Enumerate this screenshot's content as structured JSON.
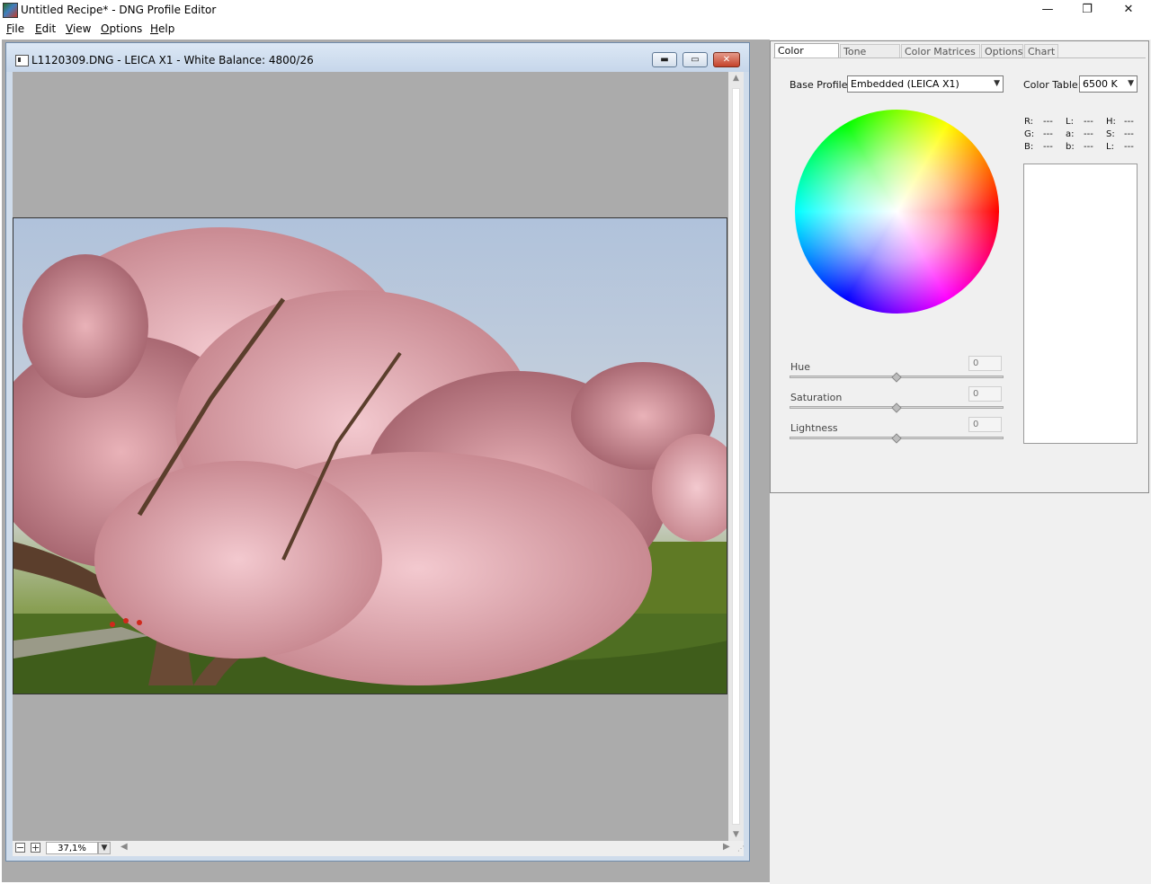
{
  "window": {
    "title": "Untitled Recipe* - DNG Profile Editor",
    "minimize": "—",
    "restore": "❐",
    "close": "✕"
  },
  "menu": {
    "items": [
      {
        "label": "File",
        "mnemonic": "F"
      },
      {
        "label": "Edit",
        "mnemonic": "E"
      },
      {
        "label": "View",
        "mnemonic": "V"
      },
      {
        "label": "Options",
        "mnemonic": "O"
      },
      {
        "label": "Help",
        "mnemonic": "H"
      }
    ]
  },
  "document": {
    "title": "L1120309.DNG  - LEICA X1 - White Balance: 4800/26",
    "minimize": "▬",
    "maximize": "▭",
    "close": "✕",
    "zoom_value": "37,1%",
    "zoom_out": "−",
    "zoom_in": "+"
  },
  "panel": {
    "tabs": [
      {
        "label": "Color Tables",
        "active": true
      },
      {
        "label": "Tone Curve",
        "active": false
      },
      {
        "label": "Color Matrices",
        "active": false
      },
      {
        "label": "Options",
        "active": false
      },
      {
        "label": "Chart",
        "active": false
      }
    ],
    "base_profile_label": "Base Profile:",
    "base_profile_value": "Embedded (LEICA X1)",
    "color_table_label": "Color Table:",
    "color_table_value": "6500 K",
    "readouts": {
      "r_label": "R:",
      "r_value": "---",
      "g_label": "G:",
      "g_value": "---",
      "b_label": "B:",
      "b_value": "---",
      "l_label": "L:",
      "l_value": "---",
      "a_label": "a:",
      "a_value": "---",
      "bb_label": "b:",
      "bb_value": "---",
      "h_label": "H:",
      "h_value": "---",
      "s_label": "S:",
      "s_value": "---",
      "ll_label": "L:",
      "ll_value": "---"
    },
    "sliders": [
      {
        "label": "Hue",
        "value": "0"
      },
      {
        "label": "Saturation",
        "value": "0"
      },
      {
        "label": "Lightness",
        "value": "0"
      }
    ]
  }
}
